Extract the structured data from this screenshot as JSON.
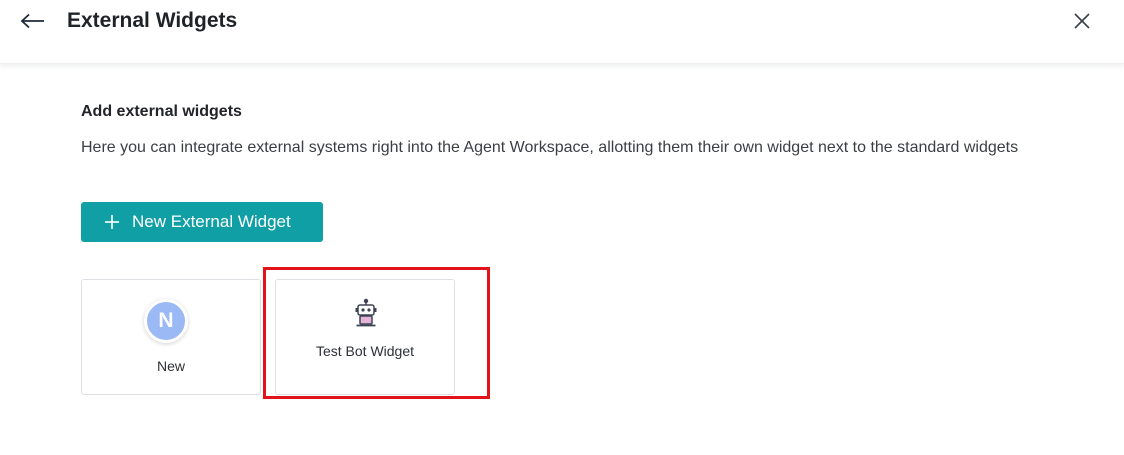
{
  "header": {
    "title": "External Widgets",
    "back_icon": "arrow-left-icon",
    "close_icon": "close-icon"
  },
  "main": {
    "section_title": "Add external widgets",
    "description": "Here you can integrate external systems right into the Agent Workspace, allotting them their own widget next to the standard widgets",
    "add_button": {
      "label": "New External Widget",
      "icon": "plus-icon"
    },
    "widgets": [
      {
        "label": "New",
        "avatar_letter": "N",
        "avatar_color": "#9bb9f5"
      },
      {
        "label": "Test Bot Widget",
        "icon": "robot-icon"
      }
    ]
  },
  "colors": {
    "accent": "#119fa6",
    "highlight": "#e3131b"
  }
}
